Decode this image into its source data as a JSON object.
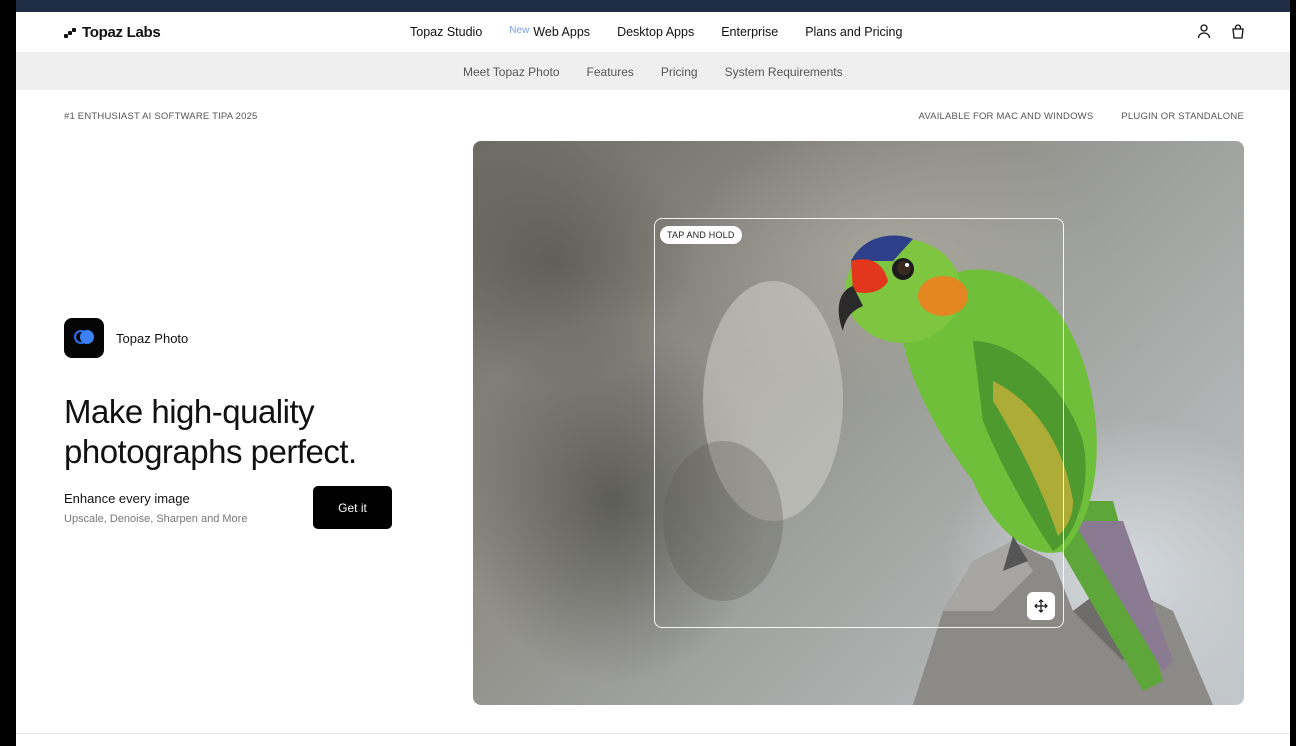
{
  "brand": {
    "name": "Topaz Labs"
  },
  "nav": {
    "items": [
      "Topaz Studio",
      "New",
      "Web Apps",
      "Desktop Apps",
      "Enterprise",
      "Plans and Pricing"
    ]
  },
  "subnav": {
    "items": [
      "Meet Topaz Photo",
      "Features",
      "Pricing",
      "System Requirements"
    ]
  },
  "tagline": {
    "left": "#1 ENTHUSIAST AI SOFTWARE TIPA 2025",
    "right": [
      "AVAILABLE FOR MAC AND WINDOWS",
      "PLUGIN OR STANDALONE"
    ]
  },
  "hero": {
    "product_name": "Topaz Photo",
    "headline": "Make high-quality photographs perfect.",
    "subtitle": "Enhance every image",
    "description": "Upscale, Denoise, Sharpen and More",
    "cta_label": "Get it",
    "compare_badge": "TAP AND HOLD"
  },
  "icons": {
    "account": "user-icon",
    "cart": "shopping-bag-icon",
    "move": "move-arrows-icon"
  },
  "colors": {
    "accent": "#3b82f6",
    "cta_bg": "#000000",
    "subnav_bg": "#efefef"
  }
}
